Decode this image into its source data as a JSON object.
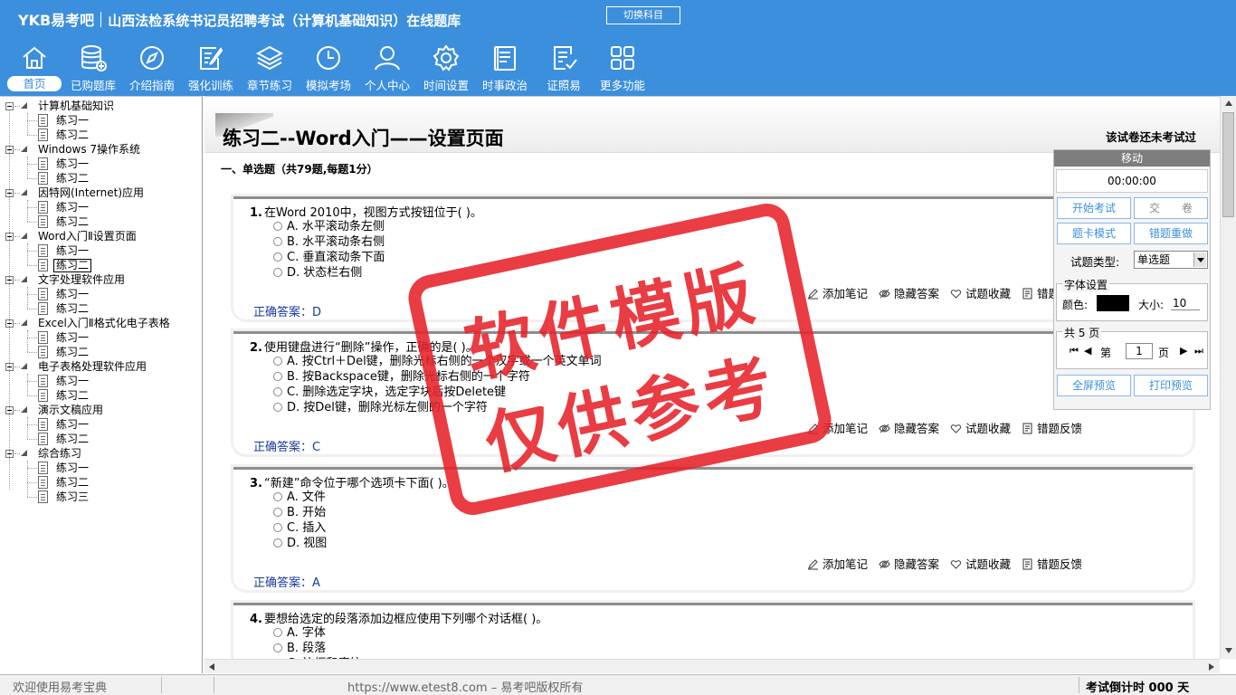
{
  "header": {
    "logo": "YKB易考吧",
    "title": "山西法检系统书记员招聘考试（计算机基础知识）在线题库",
    "switch_subject": "切换科目"
  },
  "nav": [
    {
      "label": "首页",
      "icon": "home-icon"
    },
    {
      "label": "已购题库",
      "icon": "database-icon"
    },
    {
      "label": "介绍指南",
      "icon": "compass-icon"
    },
    {
      "label": "强化训练",
      "icon": "edit-icon"
    },
    {
      "label": "章节练习",
      "icon": "layers-icon"
    },
    {
      "label": "模拟考场",
      "icon": "clock-icon"
    },
    {
      "label": "个人中心",
      "icon": "user-icon"
    },
    {
      "label": "时间设置",
      "icon": "gear-icon"
    },
    {
      "label": "时事政治",
      "icon": "document-icon"
    },
    {
      "label": "证照易",
      "icon": "checklist-icon"
    },
    {
      "label": "更多功能",
      "icon": "grid-icon"
    }
  ],
  "tree": [
    {
      "label": "计算机基础知识",
      "children": [
        "练习一",
        "练习二"
      ]
    },
    {
      "label": "Windows 7操作系统",
      "children": [
        "练习一",
        "练习二"
      ]
    },
    {
      "label": "因特网(Internet)应用",
      "children": [
        "练习一",
        "练习二"
      ]
    },
    {
      "label": "Word入门Ⅱ设置页面",
      "children": [
        "练习一",
        "练习二"
      ]
    },
    {
      "label": "文字处理软件应用",
      "children": [
        "练习一",
        "练习二"
      ]
    },
    {
      "label": "Excel入门Ⅱ格式化电子表格",
      "children": [
        "练习一",
        "练习二"
      ]
    },
    {
      "label": "电子表格处理软件应用",
      "children": [
        "练习一",
        "练习二"
      ]
    },
    {
      "label": "演示文稿应用",
      "children": [
        "练习一",
        "练习二"
      ]
    },
    {
      "label": "综合练习",
      "children": [
        "练习一",
        "练习二",
        "练习三"
      ]
    }
  ],
  "main": {
    "paper_title": "练习二--Word入门——设置页面",
    "not_tested": "该试卷还未考试过",
    "section_title": "一、单选题（共79题,每题1分）",
    "actions": {
      "note": "添加笔记",
      "hide": "隐藏答案",
      "fav": "试题收藏",
      "feedback": "错题反馈"
    },
    "answer_label": "正确答案：",
    "questions": [
      {
        "num": "1.",
        "text": "在Word 2010中，视图方式按钮位于(  )。",
        "options": [
          "A. 水平滚动条左侧",
          "B. 水平滚动条右侧",
          "C. 垂直滚动条下面",
          "D. 状态栏右侧"
        ],
        "answer": "D"
      },
      {
        "num": "2.",
        "text": "使用键盘进行“删除”操作，正确的是(  )。",
        "options": [
          "A. 按Ctrl＋Del键，删除光标右侧的一个汉字或一个英文单词",
          "B. 按Backspace键，删除光标右侧的一个字符",
          "C. 删除选定字块，选定字块后按Delete键",
          "D. 按Del键，删除光标左侧的一个字符"
        ],
        "answer": "C"
      },
      {
        "num": "3.",
        "text": "“新建”命令位于哪个选项卡下面(  )。",
        "options": [
          "A. 文件",
          "B. 开始",
          "C. 插入",
          "D. 视图"
        ],
        "answer": "A"
      },
      {
        "num": "4.",
        "text": "要想给选定的段落添加边框应使用下列哪个对话框(  )。",
        "options": [
          "A. 字体",
          "B. 段落",
          "C. 边框和底纹"
        ],
        "answer": ""
      }
    ]
  },
  "panel": {
    "move": "移动",
    "timer": "00:00:00",
    "start_exam": "开始考试",
    "submit": "交　　卷",
    "card_mode": "题卡模式",
    "wrong_redo": "错题重做",
    "type_label": "试题类型:",
    "type_value": "单选题",
    "font_legend": "字体设置",
    "color_label": "颜色:",
    "size_label": "大小:",
    "size_value": "10",
    "pages_legend": "共 5 页",
    "page_prefix": "第",
    "page_value": "1",
    "page_suffix": "页",
    "fullscreen": "全屏预览",
    "print": "打印预览"
  },
  "status": {
    "welcome": "欢迎使用易考宝典",
    "copyright": "https://www.etest8.com – 易考吧版权所有",
    "countdown": "考试倒计时 000 天"
  },
  "watermark": {
    "line1": "软件模版",
    "line2": "仅供参考"
  },
  "colors": {
    "header_bg": "#3c8fdc",
    "stamp": "#e8222a",
    "answer": "#1a3a9c"
  }
}
